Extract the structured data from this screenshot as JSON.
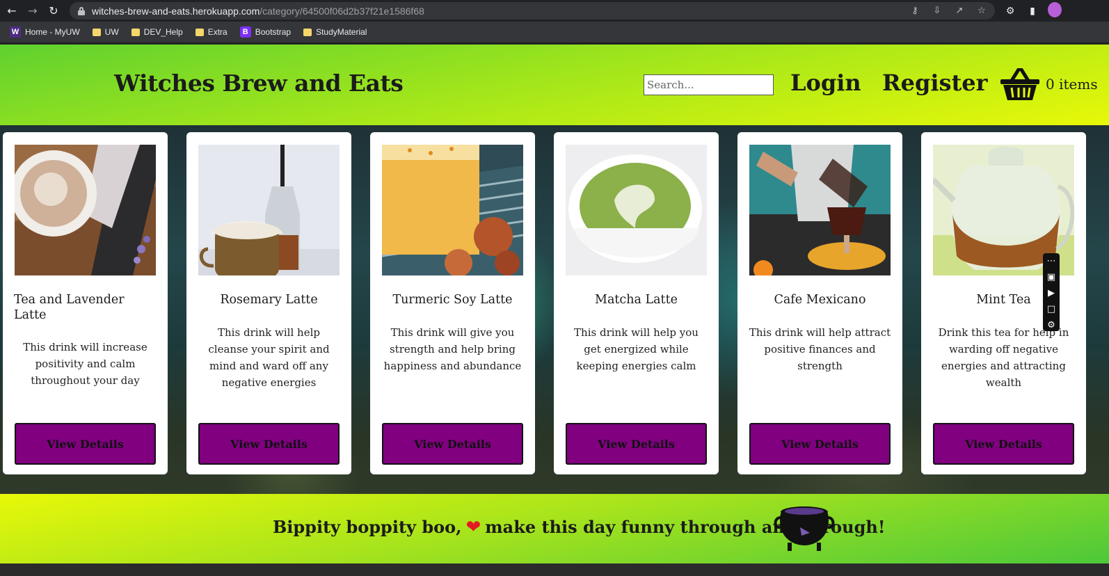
{
  "browser": {
    "url_host": "witches-brew-and-eats.herokuapp.com",
    "url_path": "/category/64500f06d2b37f21e1586f68",
    "bookmarks": [
      "Home - MyUW",
      "UW",
      "DEV_Help",
      "Extra",
      "Bootstrap",
      "StudyMaterial"
    ]
  },
  "navbar": {
    "brand": "Witches Brew and Eats",
    "search_placeholder": "Search...",
    "login": "Login",
    "register": "Register",
    "cart_count": "0 items"
  },
  "products": [
    {
      "title": "Tea and Lavender Latte",
      "description": "This drink will increase positivity and calm throughout your day",
      "button": "View Details"
    },
    {
      "title": "Rosemary Latte",
      "description": "This drink will help cleanse your spirit and mind and ward off any negative energies",
      "button": "View Details"
    },
    {
      "title": "Turmeric Soy Latte",
      "description": "This drink will give you strength and help bring happiness and abundance",
      "button": "View Details"
    },
    {
      "title": "Matcha Latte",
      "description": "This drink will help you get energized while keeping energies calm",
      "button": "View Details"
    },
    {
      "title": "Cafe Mexicano",
      "description": "This drink will help attract positive finances and strength",
      "button": "View Details"
    },
    {
      "title": "Mint Tea",
      "description": "Drink this tea for help in warding off negative energies and attracting wealth",
      "button": "View Details"
    }
  ],
  "footer": {
    "text_before": "Bippity boppity boo,",
    "text_after": "make this day funny through and through!"
  },
  "colors": {
    "button_purple": "#800080",
    "navbar_gradient_start": "#5fd12f",
    "navbar_gradient_end": "#e8f808"
  }
}
